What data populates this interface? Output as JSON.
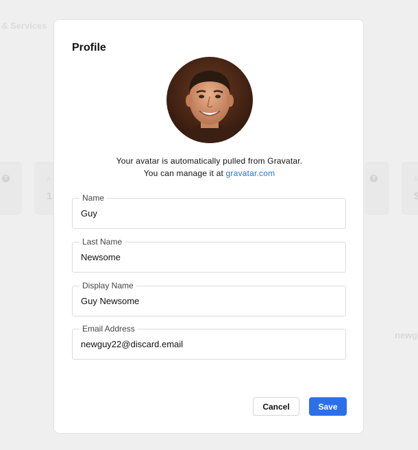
{
  "background": {
    "breadcrumb_fragment": "& Services",
    "email_fragment": "newg",
    "number_left": "1",
    "number_right": "$",
    "small_left": "A",
    "small_right": "A",
    "help_glyph": "?"
  },
  "modal": {
    "title": "Profile",
    "avatar_icon": "user-avatar-photo",
    "avatar_note_line1": "Your avatar is automatically pulled from Gravatar.",
    "avatar_note_line2_prefix": "You can manage it at ",
    "avatar_link_text": "gravatar.com"
  },
  "fields": {
    "name": {
      "label": "Name",
      "value": "Guy"
    },
    "last_name": {
      "label": "Last Name",
      "value": "Newsome"
    },
    "display_name": {
      "label": "Display Name",
      "value": "Guy Newsome"
    },
    "email": {
      "label": "Email Address",
      "value": "newguy22@discard.email"
    }
  },
  "actions": {
    "cancel_label": "Cancel",
    "save_label": "Save"
  },
  "colors": {
    "accent": "#2b70e8",
    "link": "#2a6fd6"
  }
}
